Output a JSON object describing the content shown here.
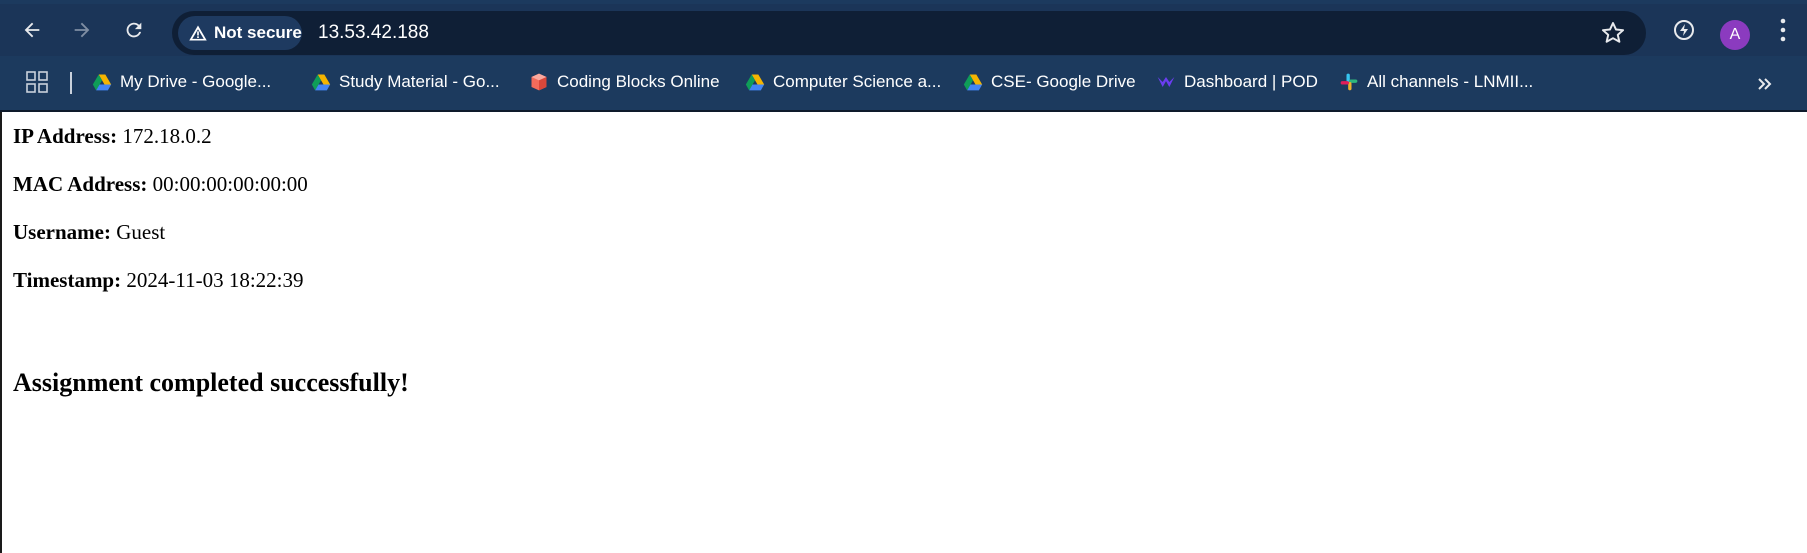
{
  "browser": {
    "security_chip": "Not secure",
    "url": "13.53.42.188",
    "avatar_letter": "A",
    "bookmarks": [
      {
        "label": "My Drive - Google...",
        "icon": "google-drive-icon"
      },
      {
        "label": "Study Material - Go...",
        "icon": "google-drive-icon"
      },
      {
        "label": "Coding Blocks Online",
        "icon": "coding-blocks-icon"
      },
      {
        "label": "Computer Science a...",
        "icon": "google-drive-icon"
      },
      {
        "label": "CSE- Google Drive",
        "icon": "google-drive-icon"
      },
      {
        "label": "Dashboard | POD",
        "icon": "pod-icon"
      },
      {
        "label": "All channels - LNMII...",
        "icon": "slack-icon"
      }
    ]
  },
  "page": {
    "ip_label": "IP Address:",
    "ip_value": "172.18.0.2",
    "mac_label": "MAC Address:",
    "mac_value": "00:00:00:00:00:00",
    "user_label": "Username:",
    "user_value": "Guest",
    "time_label": "Timestamp:",
    "time_value": "2024-11-03 18:22:39",
    "success": "Assignment completed successfully!"
  },
  "colors": {
    "toolbar": "#1b3558",
    "omnibox": "#0f1f36",
    "avatar": "#8b3bbf"
  }
}
